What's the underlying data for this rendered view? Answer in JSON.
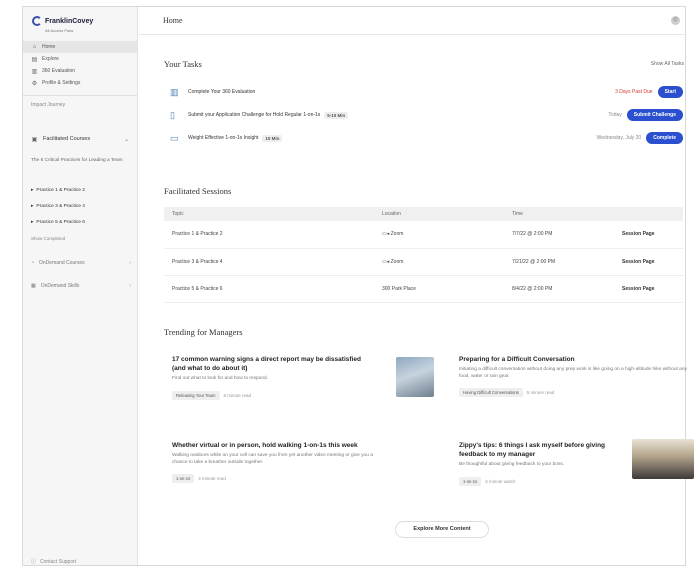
{
  "brand": {
    "name": "FranklinCovey",
    "sub": "All Access Pass"
  },
  "sidebar": {
    "nav": [
      {
        "label": "Home",
        "icon": "home-icon"
      },
      {
        "label": "Explore",
        "icon": "explore-icon"
      },
      {
        "label": "360 Evaluation",
        "icon": "chart-icon"
      },
      {
        "label": "Profile & Settings",
        "icon": "gear-icon"
      }
    ],
    "section_label": "Impact Journey",
    "courses_label": "Facilitated Courses",
    "practice_desc": "The 6 Critical Practices for Leading a Team",
    "practices": [
      "Practice 1 & Practice 2",
      "Practice 3 & Practice 4",
      "Practice 5 & Practice 6"
    ],
    "show_completed": "Show Completed",
    "on_demand_courses": "OnDemand Courses",
    "on_demand_skills": "OnDemand Skills",
    "support": "Contact Support"
  },
  "header": {
    "title": "Home"
  },
  "tasks": {
    "title": "Your Tasks",
    "show_all": "Show All Tasks",
    "items": [
      {
        "text": "Complete Your 360 Evaluation",
        "tag": "",
        "status": "3 Days Past Due",
        "status_red": true,
        "button": "Start"
      },
      {
        "text": "Submit your Application Challenge for Hold Regular 1-on-1s",
        "tag": "5-10 Min",
        "status": "Today",
        "status_red": false,
        "button": "Submit Challenge"
      },
      {
        "text": "Weight Effective 1-on-1s Insight",
        "tag": "10 Min",
        "status": "Wednesday, July 20",
        "status_red": false,
        "button": "Complete"
      }
    ]
  },
  "sessions": {
    "title": "Facilitated Sessions",
    "columns": [
      "Topic",
      "Location",
      "Time",
      ""
    ],
    "rows": [
      {
        "topic": "Practice 1 & Practice 2",
        "location": "Zoom",
        "time": "7/7/22 @ 2:00 PM",
        "action": "Session Page"
      },
      {
        "topic": "Practice 3 & Practice 4",
        "location": "Zoom",
        "time": "7/21/22 @ 2:00 PM",
        "action": "Session Page"
      },
      {
        "topic": "Practice 5 & Practice 6",
        "location": "300 Park Place",
        "time": "8/4/22 @ 2:00 PM",
        "action": "Session Page"
      }
    ]
  },
  "trending": {
    "title": "Trending for Managers",
    "articles": [
      {
        "title": "17 common warning signs a direct report may be dissatisfied (and what to do about it)",
        "desc": "Find out what to look for and how to respond.",
        "chip": "Releasing Your Team",
        "mins": "8 minute read"
      },
      {
        "title": "Preparing for a Difficult Conversation",
        "desc": "Initiating a difficult conversation without doing any prep work is like going on a high-altitude hike without any food, water or rain gear.",
        "chip": "Having Difficult Conversations",
        "mins": "5 minute read"
      },
      {
        "title": "Whether virtual or in person, hold walking 1-on-1s this week",
        "desc": "Walking outdoors while on your cell can save you from yet another video meeting or give you a chance to take a breather outside together.",
        "chip": "1-on-1s",
        "mins": "4 minute read"
      },
      {
        "title": "Zippy's tips: 6 things I ask myself before giving feedback to my manager",
        "desc": "Be thoughtful about giving feedback to your boss.",
        "chip": "1-on-1s",
        "mins": "6 minute watch"
      }
    ],
    "explore": "Explore More Content"
  },
  "colors": {
    "primary": "#2a4fcf",
    "alert": "#d43a32"
  }
}
